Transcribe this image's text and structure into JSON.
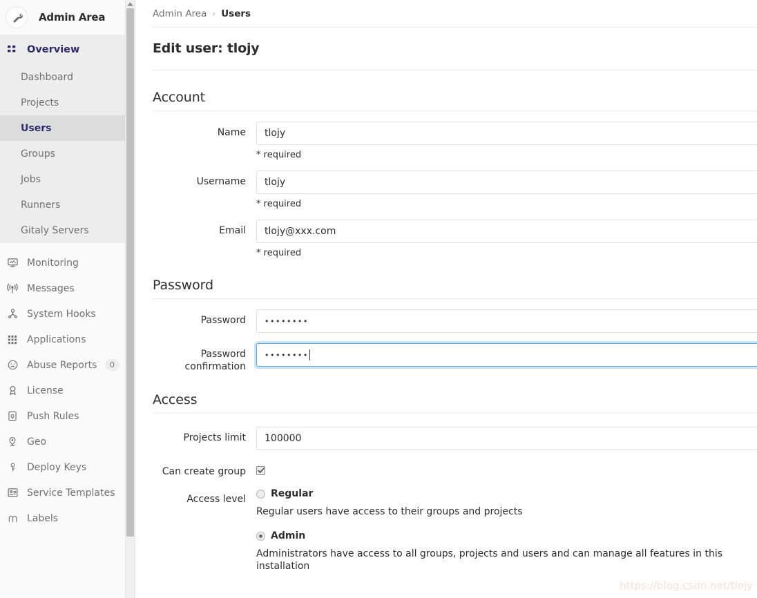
{
  "sidebar": {
    "title": "Admin Area",
    "avatar_icon": "wrench-icon",
    "overview": {
      "label": "Overview",
      "icon": "grid-icon"
    },
    "sub_items": [
      {
        "label": "Dashboard",
        "active": false
      },
      {
        "label": "Projects",
        "active": false
      },
      {
        "label": "Users",
        "active": true
      },
      {
        "label": "Groups",
        "active": false
      },
      {
        "label": "Jobs",
        "active": false
      },
      {
        "label": "Runners",
        "active": false
      },
      {
        "label": "Gitaly Servers",
        "active": false
      }
    ],
    "items": [
      {
        "label": "Monitoring",
        "icon": "monitor-icon",
        "badge": null
      },
      {
        "label": "Messages",
        "icon": "broadcast-icon",
        "badge": null
      },
      {
        "label": "System Hooks",
        "icon": "hook-icon",
        "badge": null
      },
      {
        "label": "Applications",
        "icon": "apps-grid-icon",
        "badge": null
      },
      {
        "label": "Abuse Reports",
        "icon": "frown-icon",
        "badge": "0"
      },
      {
        "label": "License",
        "icon": "award-icon",
        "badge": null
      },
      {
        "label": "Push Rules",
        "icon": "push-rules-icon",
        "badge": null
      },
      {
        "label": "Geo",
        "icon": "location-pin-icon",
        "badge": null
      },
      {
        "label": "Deploy Keys",
        "icon": "key-icon",
        "badge": null
      },
      {
        "label": "Service Templates",
        "icon": "template-icon",
        "badge": null
      },
      {
        "label": "Labels",
        "icon": "label-icon",
        "badge": null
      }
    ]
  },
  "breadcrumb": {
    "root": "Admin Area",
    "separator": "›",
    "current": "Users"
  },
  "page": {
    "title": "Edit user: tlojy"
  },
  "account": {
    "section_title": "Account",
    "name_label": "Name",
    "name_value": "tlojy",
    "name_help": "* required",
    "username_label": "Username",
    "username_value": "tlojy",
    "username_help": "* required",
    "email_label": "Email",
    "email_value": "tlojy@xxx.com",
    "email_help": "* required"
  },
  "password": {
    "section_title": "Password",
    "password_label": "Password",
    "password_value": "••••••••",
    "confirmation_label": "Password confirmation",
    "confirmation_value": "••••••••"
  },
  "access": {
    "section_title": "Access",
    "projects_limit_label": "Projects limit",
    "projects_limit_value": "100000",
    "can_create_group_label": "Can create group",
    "can_create_group_checked": true,
    "access_level_label": "Access level",
    "levels": [
      {
        "label": "Regular",
        "description": "Regular users have access to their groups and projects",
        "selected": false
      },
      {
        "label": "Admin",
        "description": "Administrators have access to all groups, projects and users and can manage all features in this installation",
        "selected": true
      }
    ]
  },
  "watermark": {
    "text": "https://blog.csdn.net/tlojy"
  },
  "colors": {
    "sidebar_bg": "#fafafa",
    "sidebar_group_bg": "#ededed",
    "active_item_bg": "#dcdcdc",
    "active_text": "#2f2a6b",
    "muted_text": "#707070",
    "focus_border": "#63a8e3",
    "body_text": "#2e2e2e"
  }
}
